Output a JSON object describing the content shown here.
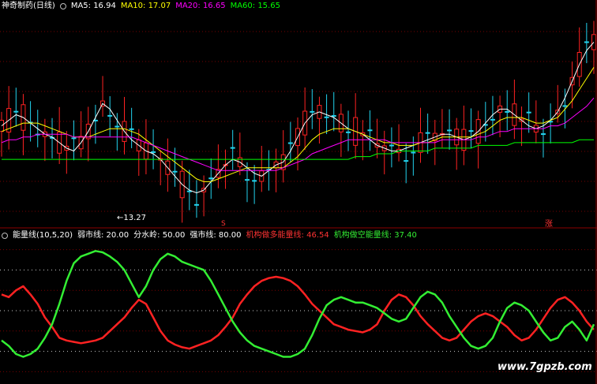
{
  "chart_data": [
    {
      "type": "candlestick",
      "title": "神奇制药(日线)",
      "legend": [
        {
          "label": "MA5: 16.94",
          "color": "#ffffff"
        },
        {
          "label": "MA10: 17.07",
          "color": "#ffff00"
        },
        {
          "label": "MA20: 16.65",
          "color": "#ff00ff"
        },
        {
          "label": "MA60: 15.65",
          "color": "#00ff00"
        }
      ],
      "price_range": [
        12.8,
        20.2
      ],
      "low_marker": {
        "label": "←13.27",
        "price": 13.27
      },
      "annotations": [
        {
          "label": "S",
          "color": "#ff3333"
        },
        {
          "label": "涨",
          "color": "#ff3333"
        }
      ],
      "series": [
        {
          "name": "MA5",
          "color": "#ffffff",
          "values": [
            16.2,
            16.4,
            16.6,
            16.5,
            16.3,
            16.1,
            15.9,
            15.8,
            15.6,
            15.4,
            15.3,
            15.6,
            16.0,
            16.5,
            17.0,
            16.8,
            16.4,
            16.0,
            15.7,
            15.5,
            15.3,
            15.2,
            15.0,
            14.7,
            14.4,
            14.1,
            13.9,
            13.8,
            13.9,
            14.2,
            14.5,
            14.8,
            15.0,
            14.9,
            14.7,
            14.5,
            14.4,
            14.6,
            14.8,
            14.9,
            15.3,
            15.8,
            16.3,
            16.6,
            16.7,
            16.6,
            16.5,
            16.3,
            16.1,
            16.0,
            15.9,
            15.7,
            15.5,
            15.4,
            15.3,
            15.3,
            15.4,
            15.5,
            15.6,
            15.7,
            15.8,
            15.9,
            15.9,
            15.8,
            15.7,
            15.8,
            16.0,
            16.3,
            16.6,
            16.8,
            16.8,
            16.6,
            16.4,
            16.2,
            16.1,
            16.2,
            16.4,
            16.7,
            17.2,
            17.8,
            18.4,
            18.9,
            19.2
          ]
        },
        {
          "name": "MA10",
          "color": "#ffff00",
          "values": [
            16.0,
            16.1,
            16.2,
            16.3,
            16.3,
            16.3,
            16.2,
            16.1,
            16.0,
            15.9,
            15.8,
            15.8,
            15.8,
            15.9,
            16.0,
            16.1,
            16.1,
            16.1,
            16.0,
            15.9,
            15.7,
            15.5,
            15.3,
            15.1,
            14.9,
            14.7,
            14.5,
            14.3,
            14.2,
            14.2,
            14.3,
            14.4,
            14.5,
            14.6,
            14.7,
            14.7,
            14.7,
            14.7,
            14.7,
            14.7,
            14.9,
            15.1,
            15.4,
            15.7,
            15.9,
            16.0,
            16.1,
            16.1,
            16.1,
            16.0,
            15.9,
            15.8,
            15.7,
            15.6,
            15.6,
            15.5,
            15.5,
            15.5,
            15.6,
            15.6,
            15.7,
            15.8,
            15.8,
            15.8,
            15.8,
            15.8,
            15.9,
            16.0,
            16.2,
            16.4,
            16.5,
            16.5,
            16.5,
            16.4,
            16.3,
            16.3,
            16.4,
            16.5,
            16.8,
            17.1,
            17.5,
            17.9,
            18.3
          ]
        },
        {
          "name": "MA20",
          "color": "#ff00ff",
          "values": [
            15.6,
            15.7,
            15.7,
            15.8,
            15.8,
            15.9,
            15.9,
            15.9,
            15.9,
            15.9,
            15.8,
            15.8,
            15.8,
            15.8,
            15.8,
            15.8,
            15.8,
            15.8,
            15.8,
            15.7,
            15.6,
            15.5,
            15.4,
            15.3,
            15.2,
            15.1,
            15.0,
            14.9,
            14.8,
            14.7,
            14.6,
            14.6,
            14.6,
            14.6,
            14.6,
            14.6,
            14.6,
            14.6,
            14.6,
            14.7,
            14.8,
            14.9,
            15.0,
            15.2,
            15.3,
            15.4,
            15.5,
            15.6,
            15.7,
            15.7,
            15.7,
            15.7,
            15.7,
            15.7,
            15.6,
            15.6,
            15.6,
            15.6,
            15.6,
            15.6,
            15.6,
            15.7,
            15.7,
            15.7,
            15.7,
            15.7,
            15.8,
            15.8,
            15.9,
            16.0,
            16.0,
            16.1,
            16.1,
            16.1,
            16.1,
            16.1,
            16.2,
            16.2,
            16.3,
            16.5,
            16.7,
            16.9,
            17.2
          ]
        },
        {
          "name": "MA60",
          "color": "#00ff00",
          "values": [
            15.0,
            15.0,
            15.0,
            15.0,
            15.0,
            15.0,
            15.0,
            15.0,
            15.0,
            15.0,
            15.0,
            15.0,
            15.0,
            15.0,
            15.0,
            15.0,
            15.0,
            15.0,
            15.0,
            15.0,
            15.0,
            15.0,
            15.0,
            15.0,
            15.0,
            15.0,
            15.0,
            15.0,
            15.0,
            15.0,
            15.0,
            15.0,
            15.0,
            15.0,
            15.0,
            15.0,
            15.0,
            15.0,
            15.0,
            15.0,
            15.0,
            15.0,
            15.0,
            15.0,
            15.0,
            15.0,
            15.0,
            15.0,
            15.0,
            15.1,
            15.1,
            15.1,
            15.2,
            15.2,
            15.2,
            15.3,
            15.3,
            15.3,
            15.3,
            15.3,
            15.4,
            15.4,
            15.4,
            15.4,
            15.4,
            15.4,
            15.5,
            15.5,
            15.5,
            15.5,
            15.5,
            15.6,
            15.6,
            15.6,
            15.6,
            15.6,
            15.6,
            15.6,
            15.6,
            15.6,
            15.7,
            15.7,
            15.7
          ]
        }
      ]
    },
    {
      "type": "line",
      "title": "能量线(10,5,20)",
      "ylim": [
        0,
        100
      ],
      "levels": [
        {
          "label": "弱市线: 20.00",
          "value": 20
        },
        {
          "label": "分水岭: 50.00",
          "value": 50
        },
        {
          "label": "强市线: 80.00",
          "value": 80
        }
      ],
      "series": [
        {
          "name": "机构做多能量线: 46.54",
          "color": "#ff2222",
          "values": [
            62,
            60,
            65,
            68,
            62,
            55,
            45,
            38,
            30,
            28,
            27,
            26,
            27,
            28,
            30,
            35,
            40,
            45,
            52,
            58,
            55,
            45,
            35,
            28,
            25,
            23,
            22,
            24,
            26,
            28,
            32,
            38,
            45,
            55,
            62,
            68,
            72,
            74,
            75,
            74,
            72,
            68,
            62,
            55,
            50,
            45,
            40,
            38,
            36,
            35,
            34,
            36,
            40,
            50,
            58,
            62,
            60,
            54,
            46,
            40,
            35,
            30,
            28,
            30,
            36,
            42,
            46,
            48,
            46,
            42,
            38,
            32,
            28,
            30,
            36,
            44,
            52,
            58,
            60,
            56,
            50,
            42,
            36
          ]
        },
        {
          "name": "机构做空能量线: 37.40",
          "color": "#33ee33",
          "values": [
            28,
            24,
            18,
            16,
            18,
            22,
            30,
            40,
            55,
            72,
            85,
            90,
            92,
            94,
            93,
            90,
            86,
            80,
            70,
            60,
            68,
            80,
            88,
            92,
            90,
            86,
            84,
            82,
            80,
            72,
            62,
            52,
            42,
            34,
            28,
            24,
            22,
            20,
            18,
            16,
            16,
            18,
            22,
            32,
            44,
            54,
            58,
            60,
            58,
            56,
            56,
            54,
            52,
            48,
            44,
            42,
            44,
            52,
            60,
            64,
            62,
            56,
            46,
            38,
            30,
            24,
            22,
            24,
            30,
            42,
            52,
            56,
            54,
            50,
            42,
            34,
            28,
            30,
            38,
            42,
            36,
            28,
            40
          ]
        }
      ]
    }
  ],
  "watermark": "www.7gpzb.com"
}
